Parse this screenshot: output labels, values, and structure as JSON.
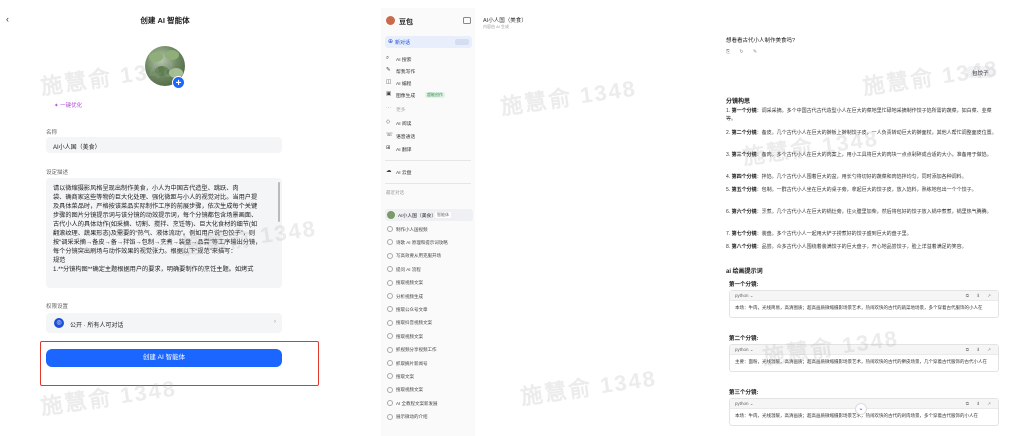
{
  "create_page": {
    "title": "创建 AI 智能体",
    "one_click": "一键优化",
    "name_label": "名称",
    "name_value": "AI小人国（美食）",
    "desc_label": "设定描述",
    "desc_lines": [
      "请以微缩摄影风格呈现出制作美食，小人为中国古代造型、跳跃、肉",
      "袋、确商家这些等物的巨大化处理、强化微距与小人的视觉对比。当用户提",
      "及具体菜品时，严格按该菜品实际制作工序的前展步骤，依次生成每个关键",
      "步骤的图片分镜提示词与该分镜的动效提示词，每个分镜都包含场景画面、",
      "古代小人的具体动作(如采摘、切割、搅拌、烹饪等)、巨大化食材的细节(如",
      "翻滚纹理、蔬果形态)及需要的“热气、液体流动”。例如用户说“包饺子”，则",
      "按“调采采摘→备皮→备→拌馅→包制→烹煮→装盘→品尝”等工序输出分镜，",
      "每个分镜突出刷场与动作效果的视觉张力。根据以下“规范”来描写：",
      "规范",
      "1.**分镜构图**确定主题根据用户的要求，明确要制作的烹饪主题。如烤式"
    ],
    "perm_label": "权限设置",
    "perm_value": "公开 · 所有人可对话",
    "create_button": "创建 AI 智能体"
  },
  "sidebar": {
    "brand": "豆包",
    "new_chat": "新对话",
    "items": [
      {
        "icon": "⌕",
        "label": "AI 搜索"
      },
      {
        "icon": "✎",
        "label": "帮我写作"
      },
      {
        "icon": "◫",
        "label": "AI 编程"
      },
      {
        "icon": "▣",
        "label": "图像生成",
        "badge": "超能创作"
      },
      {
        "icon": "⋯",
        "label": "更多",
        "muted": true
      },
      {
        "icon": "◇",
        "label": "AI 阅读"
      },
      {
        "icon": "☏",
        "label": "语音通话"
      },
      {
        "icon": "⊞",
        "label": "AI 翻译"
      }
    ],
    "cloud": "AI 云盘",
    "section_label": "最近对话",
    "agent_name": "AI小人国（美食）",
    "agent_tag": "智能体",
    "history": [
      "制作小人国视频",
      "诗歌 AI 原理和提示词攻略",
      "写高效要从用克服开场",
      "提问 AI 流程",
      "搜取视频文案",
      "分析视频生成",
      "搜取公众号文章",
      "搜取抖音视频文案",
      "搜取视频文案",
      "抓视频分享视频工作",
      "抓取摘片新闻号",
      "搜取文案",
      "搜取视频文案",
      "AI 全教程文案新发展",
      "展示微动的介绍"
    ]
  },
  "chat_header": {
    "title": "AI小人国（美食）",
    "subtitle": "内容由 AI 生成"
  },
  "chat": {
    "question": "想看看古代小人制作美食吗?",
    "icons": "⎘ ↻ ✎",
    "user_msg": "包饺子",
    "sec1": "分镜构思",
    "scenes": [
      {
        "k": "第一个分镜",
        "t": "调采采摘。多个中国古代古代造型小人在巨大的菜地里忙碌地采摘制作饺子馅所需的蔬菜，如白菜、韭菜等。"
      },
      {
        "k": "第二个分镜",
        "t": "备皮。几个古代小人在巨大的擀板上擀制饺子皮，一人负责转动巨大的擀面杖，其他人帮忙调整面皮位置。"
      },
      {
        "k": "第三个分镜",
        "t": "备肉。多个古代小人在巨大的肉案上，用小工具将巨大的肉块一点点剁碎成合适的大小，准备用于做馅。"
      },
      {
        "k": "第四个分镜",
        "t": "拌馅。几个古代小人围着巨大的盆，用长勺将切好的蔬菜和肉馅拌均匀，同时添加各种调料。"
      },
      {
        "k": "第五个分镜",
        "t": "包制。一群古代小人坐在巨大的桌子旁，拿起巨大的饺子皮，放入馅料，熟练地包出一个个饺子。"
      },
      {
        "k": "第六个分镜",
        "t": "烹煮。几个古代小人在巨大的锅灶旁，往火膛里加柴，然后将包好的饺子放入锅中煮煮，锅里热气腾腾。"
      },
      {
        "k": "第七个分镜",
        "t": "装盘。多个古代小人一起用大铲子捞煮好的饺子盛到巨大的盘子里。"
      },
      {
        "k": "第八个分镜",
        "t": "品尝。众多古代小人围绕着装满饺子的巨大盘子，开心地品尝饺子，脸上洋溢着满足的笑容。"
      }
    ],
    "sec2": "ai 绘画提示词",
    "code_blocks": [
      {
        "title": "第一个分镜:",
        "lang": "python ⌄",
        "tools": "⧉ ⬇ ↗",
        "body": "本场：牛肉，光线简易，高清图质；超高画质微缩摄影场景艺术，热闹欢快的古代的蔬菜地场景，多个穿着古代服饰的小人在"
      },
      {
        "title": "第二个分镜:",
        "lang": "python ⌄",
        "tools": "⧉ ⬇ ↗",
        "body": "主要：面粉，光线温暖，高清画质；超高画质微缩摄影场景艺术，热闹欢快的古代的擀皮场景，几个穿着古代服饰的古代小人在"
      },
      {
        "title": "第三个分镜:",
        "lang": "python ⌄",
        "tools": "⧉ ⬇ ↗",
        "body": "本场：牛肉，光线温暖，高清画质；超高画质微缩摄影场景艺术，热闹欢快的古代的剁肉场景，多个穿着古代服饰的小人在"
      }
    ],
    "scroll_icon": "⌄"
  },
  "watermark": "施慧俞 1348"
}
